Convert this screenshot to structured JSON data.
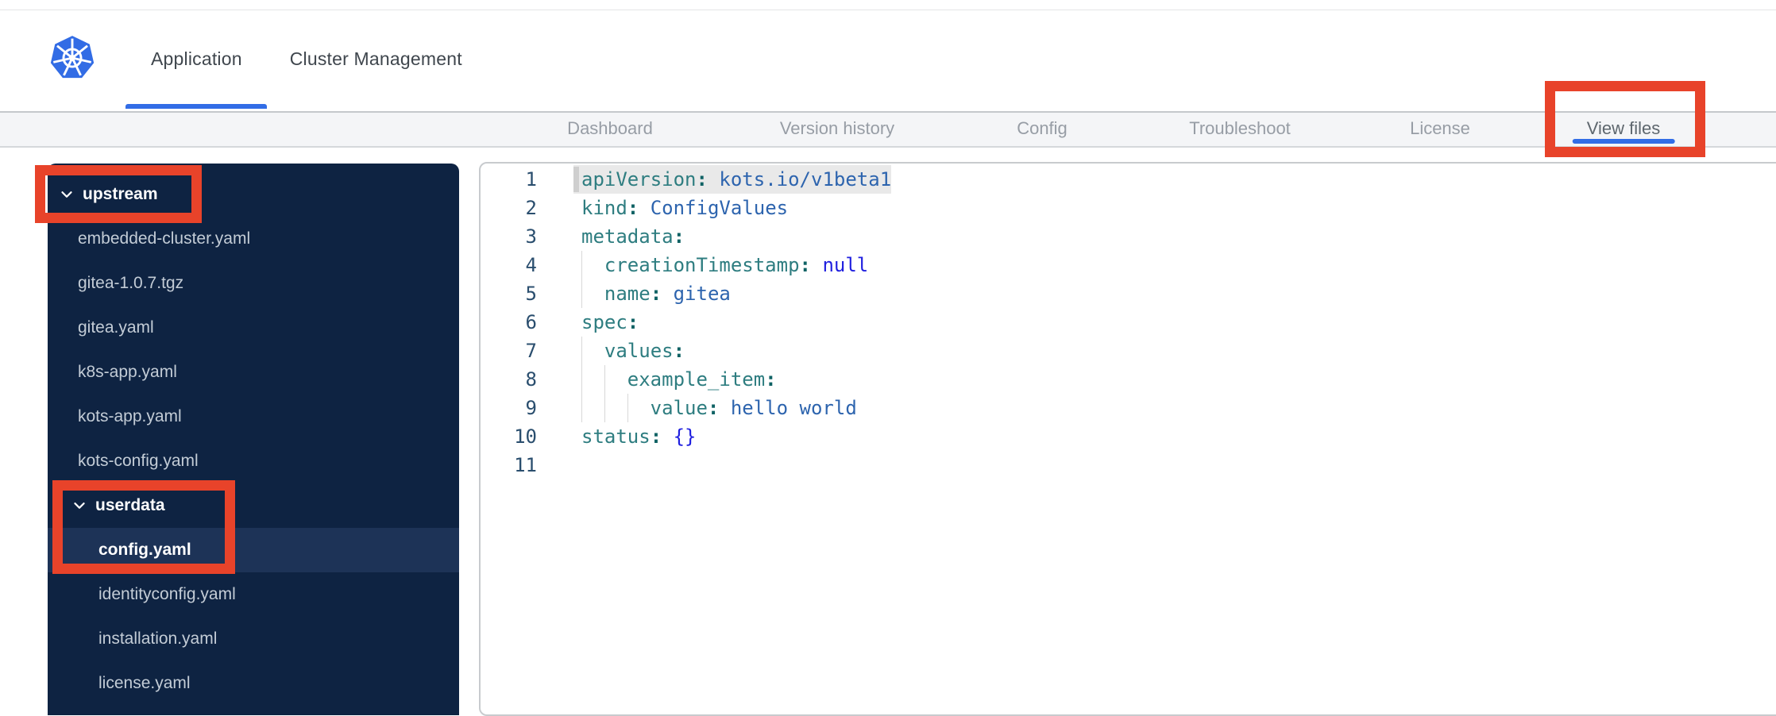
{
  "header": {
    "logo": "kubernetes",
    "tabs": [
      {
        "label": "Application",
        "active": true
      },
      {
        "label": "Cluster Management",
        "active": false
      }
    ]
  },
  "nav": {
    "tabs": [
      {
        "label": "Dashboard",
        "active": false
      },
      {
        "label": "Version history",
        "active": false
      },
      {
        "label": "Config",
        "active": false
      },
      {
        "label": "Troubleshoot",
        "active": false
      },
      {
        "label": "License",
        "active": false
      },
      {
        "label": "View files",
        "active": true
      }
    ]
  },
  "file_tree": {
    "items": [
      {
        "label": "upstream",
        "type": "folder",
        "depth": 0,
        "expanded": true
      },
      {
        "label": "embedded-cluster.yaml",
        "type": "file",
        "depth": 1
      },
      {
        "label": "gitea-1.0.7.tgz",
        "type": "file",
        "depth": 1
      },
      {
        "label": "gitea.yaml",
        "type": "file",
        "depth": 1
      },
      {
        "label": "k8s-app.yaml",
        "type": "file",
        "depth": 1
      },
      {
        "label": "kots-app.yaml",
        "type": "file",
        "depth": 1
      },
      {
        "label": "kots-config.yaml",
        "type": "file",
        "depth": 1
      },
      {
        "label": "userdata",
        "type": "folder",
        "depth": 1,
        "expanded": true
      },
      {
        "label": "config.yaml",
        "type": "file",
        "depth": 2,
        "selected": true
      },
      {
        "label": "identityconfig.yaml",
        "type": "file",
        "depth": 2
      },
      {
        "label": "installation.yaml",
        "type": "file",
        "depth": 2
      },
      {
        "label": "license.yaml",
        "type": "file",
        "depth": 2
      }
    ]
  },
  "editor": {
    "language": "yaml",
    "lines": [
      {
        "n": 1,
        "indent": 0,
        "selected": true,
        "tokens": [
          [
            "key",
            "apiVersion"
          ],
          [
            "colon",
            ": "
          ],
          [
            "val",
            "kots.io/v1beta1"
          ]
        ]
      },
      {
        "n": 2,
        "indent": 0,
        "tokens": [
          [
            "key",
            "kind"
          ],
          [
            "colon",
            ": "
          ],
          [
            "val",
            "ConfigValues"
          ]
        ]
      },
      {
        "n": 3,
        "indent": 0,
        "tokens": [
          [
            "key",
            "metadata"
          ],
          [
            "colon",
            ":"
          ]
        ]
      },
      {
        "n": 4,
        "indent": 1,
        "tokens": [
          [
            "key",
            "creationTimestamp"
          ],
          [
            "colon",
            ": "
          ],
          [
            "kw",
            "null"
          ]
        ]
      },
      {
        "n": 5,
        "indent": 1,
        "tokens": [
          [
            "key",
            "name"
          ],
          [
            "colon",
            ": "
          ],
          [
            "val",
            "gitea"
          ]
        ]
      },
      {
        "n": 6,
        "indent": 0,
        "tokens": [
          [
            "key",
            "spec"
          ],
          [
            "colon",
            ":"
          ]
        ]
      },
      {
        "n": 7,
        "indent": 1,
        "tokens": [
          [
            "key",
            "values"
          ],
          [
            "colon",
            ":"
          ]
        ]
      },
      {
        "n": 8,
        "indent": 2,
        "tokens": [
          [
            "key",
            "example_item"
          ],
          [
            "colon",
            ":"
          ]
        ]
      },
      {
        "n": 9,
        "indent": 3,
        "tokens": [
          [
            "key",
            "value"
          ],
          [
            "colon",
            ": "
          ],
          [
            "val",
            "hello world"
          ]
        ]
      },
      {
        "n": 10,
        "indent": 0,
        "tokens": [
          [
            "key",
            "status"
          ],
          [
            "colon",
            ": "
          ],
          [
            "kw",
            "{}"
          ]
        ]
      },
      {
        "n": 11,
        "indent": 0,
        "tokens": []
      }
    ]
  },
  "annotations": [
    {
      "id": "upstream",
      "target": "upstream folder"
    },
    {
      "id": "userdata-config",
      "target": "userdata folder and config.yaml file"
    },
    {
      "id": "view-files",
      "target": "View files tab"
    }
  ],
  "colors": {
    "accent_blue": "#326de6",
    "annotation_red": "#e8432a",
    "sidebar_bg": "#0e2342",
    "sidebar_selected_row": "#1d3357",
    "yaml_key": "#2e7d80",
    "yaml_value": "#2d64ae",
    "yaml_keyword": "#2020df"
  }
}
